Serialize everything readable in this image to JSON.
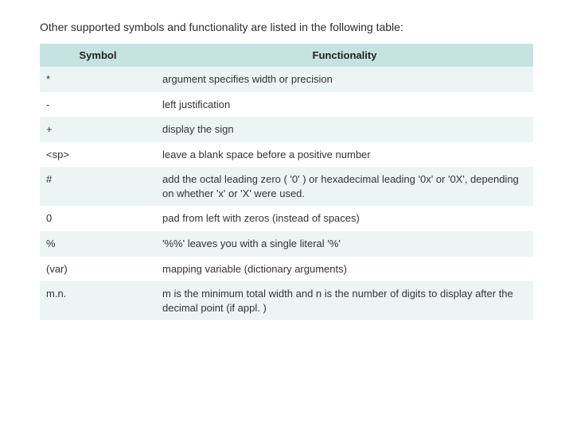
{
  "intro": "Other supported symbols and functionality are listed in the following table:",
  "headers": {
    "symbol": "Symbol",
    "functionality": "Functionality"
  },
  "rows": [
    {
      "symbol": "*",
      "functionality": "argument specifies width or precision"
    },
    {
      "symbol": "-",
      "functionality": "left justification"
    },
    {
      "symbol": "+",
      "functionality": "display the sign"
    },
    {
      "symbol": "<sp>",
      "functionality": "leave a blank space before a positive number"
    },
    {
      "symbol": "#",
      "functionality": "add the octal leading zero ( '0' ) or hexadecimal leading '0x' or '0X', depending on whether 'x' or 'X' were used."
    },
    {
      "symbol": "0",
      "functionality": "pad from left with zeros (instead of spaces)"
    },
    {
      "symbol": "%",
      "functionality": "'%%' leaves you with a single literal '%'"
    },
    {
      "symbol": "(var)",
      "functionality": "mapping variable (dictionary arguments)"
    },
    {
      "symbol": "m.n.",
      "functionality": "m is the minimum total width and n is the number of digits to display after the decimal point (if appl. )"
    }
  ]
}
